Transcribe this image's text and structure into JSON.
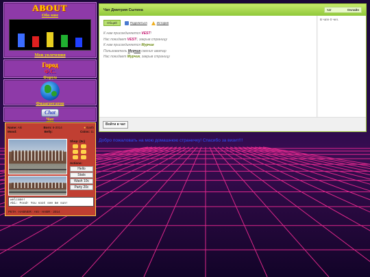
{
  "left_nav": {
    "about_logo": "ABOUT",
    "about_link": "Обо мне",
    "hobbies_link": "Мои увлечения",
    "forum_logo_top": "Город",
    "forum_logo_bottom": "Ф.С.",
    "forum_link": "Форум",
    "aggregator_link": "Фидагрегатор",
    "chat_logo": "Chat",
    "chat_link": "Чат"
  },
  "pet": {
    "name_label": "Name:",
    "name_value": "Aki",
    "born_label": "Born:",
    "born_value": "6-2014",
    "planet_value": "Earth",
    "mood_label": "Mood:",
    "mood_value": "",
    "belly_label": "Belly:",
    "belly_value": "",
    "coins_label": "Coins:",
    "coins_value": "11",
    "shop_label": "Shop: (5c)",
    "actions_label": "Actions:",
    "actions": [
      "Hello",
      "Stats",
      "Wash 10c",
      "Party 20c"
    ],
    "log_line1": "welcome!",
    "log_line2": "Aki: Food! You soot see me sun!",
    "footer": "PETA  ·  HABNER  ·  AKI  ·  HABR  · 2014"
  },
  "chat": {
    "title": "Чат Дмитрия Сытина",
    "status_label": "чат",
    "status_value": "Онлайн",
    "tabs": {
      "general": "Общий",
      "share": "Поделиться",
      "history": "История"
    },
    "messages": [
      {
        "prefix": "К нам присоединяется ",
        "user": "VEST",
        "suffix": "!"
      },
      {
        "prefix": "Нас покидает ",
        "user": "VEST",
        "suffix": "!, закрыв страницу"
      },
      {
        "prefix": "К нам присоединяется ",
        "user": "Мурчик",
        "suffix": ""
      },
      {
        "prefix": "Пользователь ",
        "user": "Мурчик",
        "suffix": " сменил аватар"
      },
      {
        "prefix": "Нас покидает ",
        "user": "Мурчик",
        "suffix": ", закрыв страницу"
      }
    ],
    "users_online": "В чате 0 чел.",
    "login_button": "Войти в чат"
  },
  "marquee": "Добро пожаловать на мою домашнюю страничку! Спасибо за визит!!!",
  "colors": {
    "accent": "#9fc93c",
    "nav_bg": "#8e3aa8",
    "pet_bg": "#c03f32",
    "user_vest": "#c0106a",
    "user_murchik": "#6a8a10"
  }
}
